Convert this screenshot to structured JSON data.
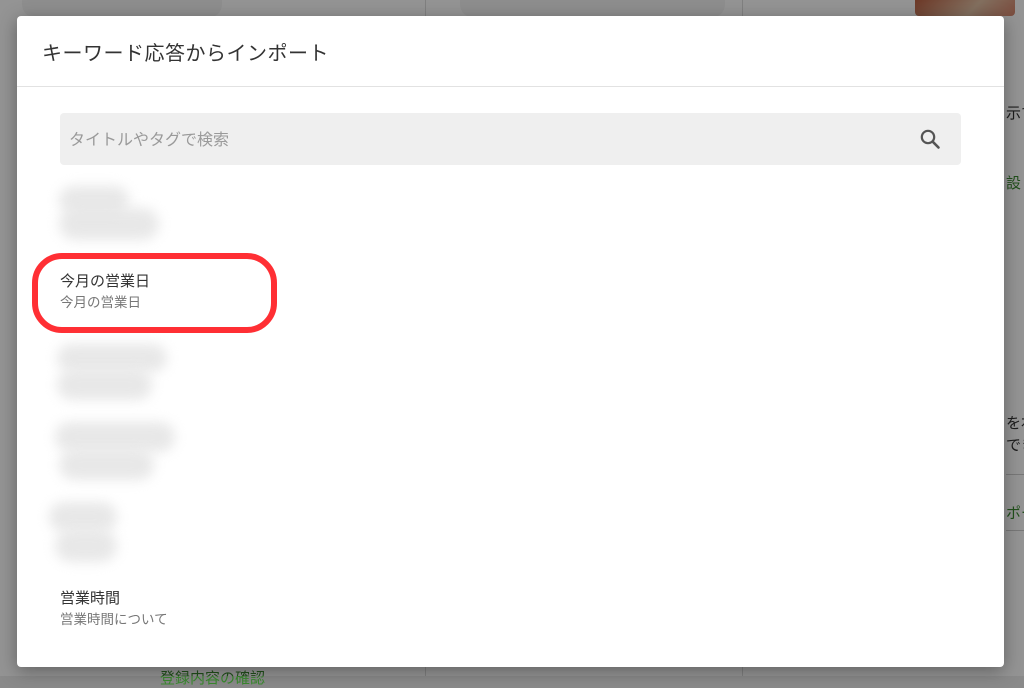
{
  "background": {
    "right_texts": [
      "示す",
      "設",
      "を右",
      "でき",
      "ポー"
    ],
    "bottom_text": "登録内容の確認"
  },
  "modal": {
    "title": "キーワード応答からインポート",
    "search": {
      "placeholder": "タイトルやタグで検索",
      "value": "",
      "icon": "search-icon"
    },
    "items": [
      {
        "title": "今月の営業日",
        "subtitle": "今月の営業日",
        "highlighted": true
      },
      {
        "title": "営業時間",
        "subtitle": "営業時間について",
        "highlighted": false
      }
    ],
    "highlight_color": "#ff2f34"
  }
}
